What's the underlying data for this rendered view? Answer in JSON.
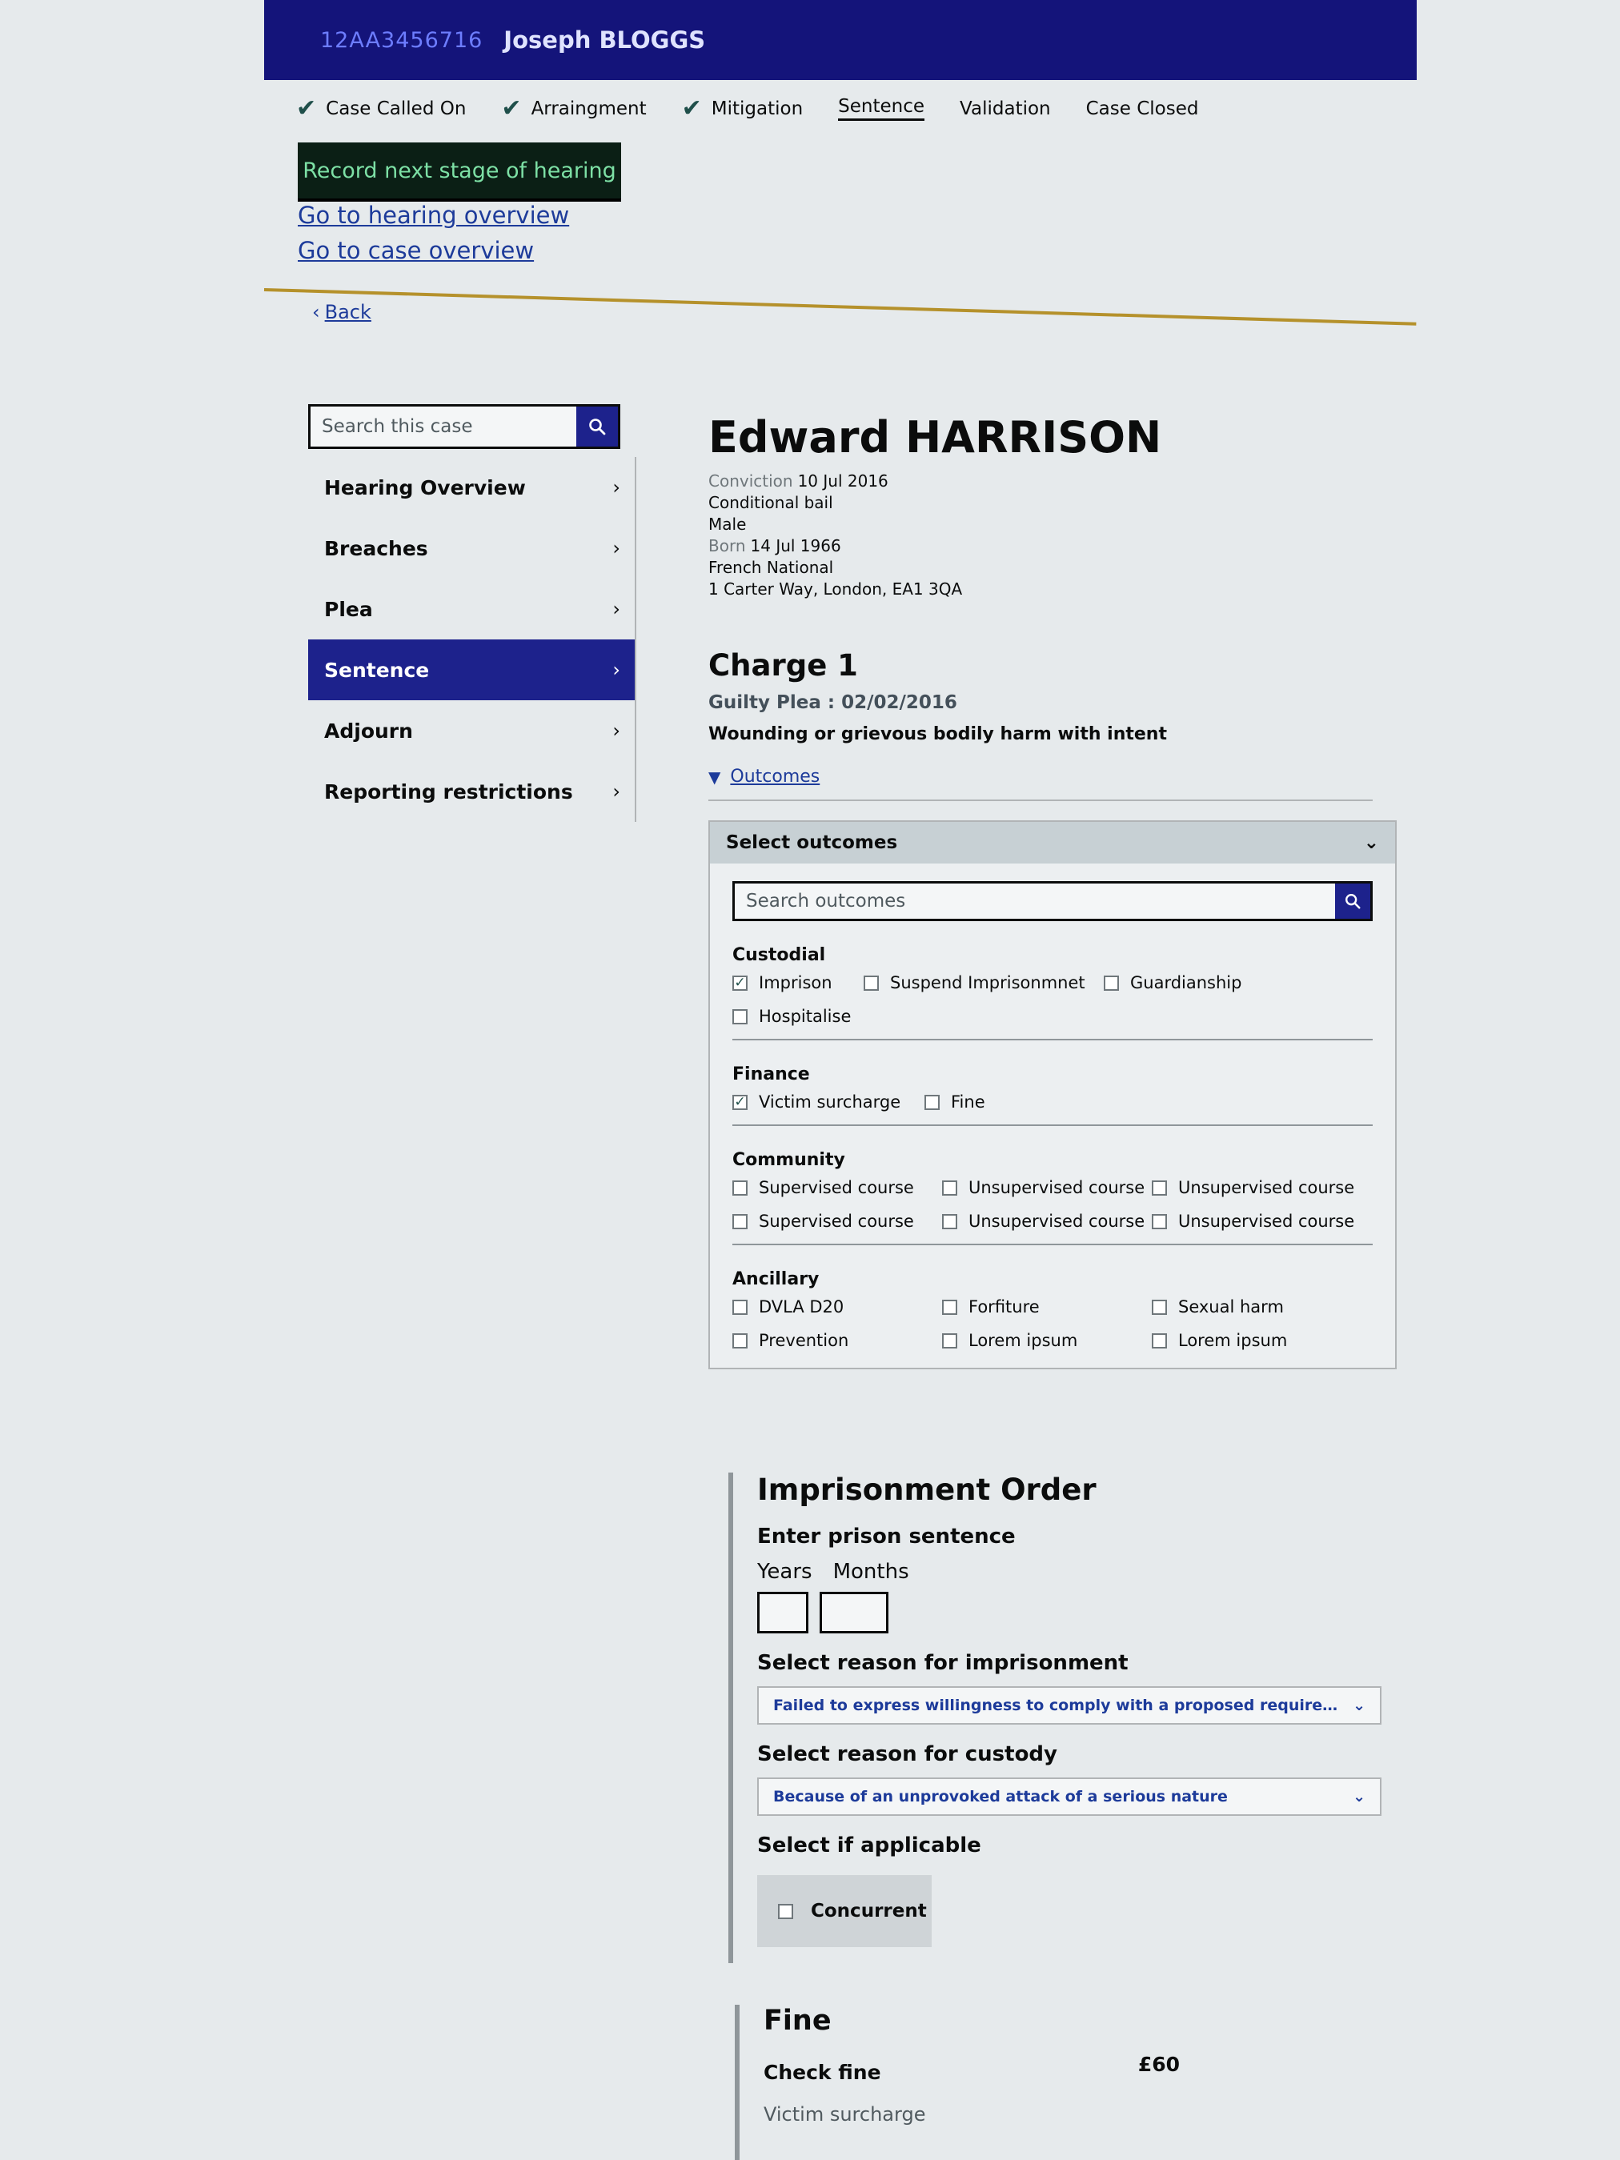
{
  "header": {
    "case_id": "12AA3456716",
    "defendant_name": "Joseph BLOGGS"
  },
  "stages": [
    {
      "label": "Case Called On",
      "done": true
    },
    {
      "label": "Arraingment",
      "done": true
    },
    {
      "label": "Mitigation",
      "done": true
    },
    {
      "label": "Sentence",
      "done": false,
      "current": true
    },
    {
      "label": "Validation",
      "done": false
    },
    {
      "label": "Case Closed",
      "done": false
    }
  ],
  "actions": {
    "next_stage_label": "Record next stage of hearing",
    "hearing_overview_link": "Go to hearing overview",
    "case_overview_link": "Go to case overview",
    "back_label": "Back"
  },
  "sidebar": {
    "search_placeholder": "Search this case",
    "items": [
      {
        "label": "Hearing Overview"
      },
      {
        "label": "Breaches"
      },
      {
        "label": "Plea"
      },
      {
        "label": "Sentence",
        "active": true
      },
      {
        "label": "Adjourn"
      },
      {
        "label": "Reporting restrictions"
      }
    ]
  },
  "defendant": {
    "name": "Edward HARRISON",
    "conviction_label": "Conviction",
    "conviction_date": "10 Jul 2016",
    "bail": "Conditional bail",
    "gender": "Male",
    "born_label": "Born",
    "born_date": "14 Jul 1966",
    "nationality": "French National",
    "address": "1 Carter Way, London, EA1 3QA"
  },
  "charge": {
    "title": "Charge 1",
    "plea": "Guilty Plea : 02/02/2016",
    "offence": "Wounding or grievous bodily harm with intent",
    "outcomes_toggle": "Outcomes"
  },
  "outcomes_panel": {
    "title": "Select outcomes",
    "search_placeholder": "Search outcomes",
    "groups": {
      "custodial": {
        "title": "Custodial",
        "options": [
          {
            "label": "Imprison",
            "checked": true
          },
          {
            "label": "Suspend Imprisonmnet",
            "checked": false
          },
          {
            "label": "Guardianship",
            "checked": false
          },
          {
            "label": "Hospitalise",
            "checked": false
          }
        ]
      },
      "finance": {
        "title": "Finance",
        "options": [
          {
            "label": "Victim surcharge",
            "checked": true
          },
          {
            "label": "Fine",
            "checked": false
          }
        ]
      },
      "community": {
        "title": "Community",
        "options": [
          {
            "label": "Supervised course",
            "checked": false
          },
          {
            "label": "Unsupervised course",
            "checked": false
          },
          {
            "label": "Unsupervised course",
            "checked": false
          },
          {
            "label": "Supervised course",
            "checked": false
          },
          {
            "label": "Unsupervised course",
            "checked": false
          },
          {
            "label": "Unsupervised course",
            "checked": false
          }
        ]
      },
      "ancillary": {
        "title": "Ancillary",
        "options": [
          {
            "label": "DVLA D20",
            "checked": false
          },
          {
            "label": "Forfiture",
            "checked": false
          },
          {
            "label": "Sexual harm",
            "checked": false
          },
          {
            "label": "Prevention",
            "checked": false
          },
          {
            "label": "Lorem ipsum",
            "checked": false
          },
          {
            "label": "Lorem ipsum",
            "checked": false
          }
        ]
      }
    }
  },
  "imprisonment_order": {
    "title": "Imprisonment Order",
    "sentence_label": "Enter prison sentence",
    "years_label": "Years",
    "months_label": "Months",
    "years_value": "",
    "months_value": "",
    "reason_imprisonment_label": "Select reason for imprisonment",
    "reason_imprisonment_value": "Failed to express willingness to comply with a proposed requirement for a comm...",
    "reason_custody_label": "Select reason for custody",
    "reason_custody_value": "Because of an unprovoked attack of a serious nature",
    "applicable_label": "Select if applicable",
    "concurrent_label": "Concurrent",
    "concurrent_checked": false
  },
  "fine": {
    "title": "Fine",
    "check_label": "Check fine",
    "amount": "£60",
    "sub_label": "Victim surcharge"
  },
  "colors": {
    "primary": "#1d228c",
    "header_bg": "#14147a",
    "accent_rule": "#b5912b",
    "button_bg": "#0b1f15",
    "button_text": "#7de0a5",
    "link": "#1d3b9a"
  }
}
